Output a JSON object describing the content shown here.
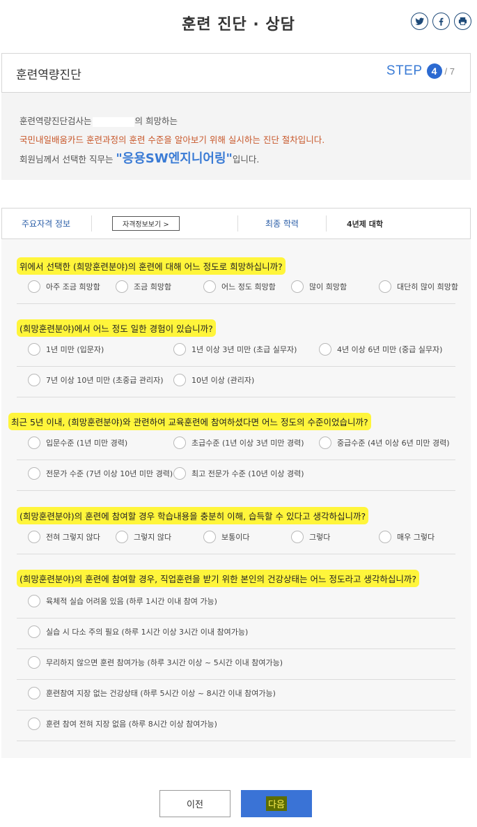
{
  "header": {
    "title": "훈련 진단 · 상담",
    "share_icons": [
      "twitter-icon",
      "facebook-icon",
      "print-icon"
    ],
    "accent_color": "#1e4a78"
  },
  "step": {
    "title": "훈련역량진단",
    "label": "STEP",
    "current": "4",
    "total": "/ 7"
  },
  "intro": {
    "line1_prefix": "훈련역량진단검사는",
    "line1_suffix": "의 희망하는",
    "line2": "국민내일배움카드 훈련과정의 훈련 수준을 알아보기 위해 실시하는 진단 절차입니다.",
    "line3_prefix": "회원님께서 선택한 직무는 ",
    "job": "\"응용SW엔지니어링\"",
    "line3_suffix": "입니다."
  },
  "info": {
    "cert_label": "주요자격 정보",
    "cert_button": "자격정보보기 >",
    "edu_label": "최종 학력",
    "edu_value": "4년제 대학"
  },
  "questions": [
    {
      "text": "위에서 선택한 (희망훈련분야)의 훈련에 대해 어느 정도로 희망하십니까?",
      "rows": [
        [
          "아주 조금 희망함",
          "조금 희망함",
          "어느 정도 희망함",
          "많이 희망함",
          "대단히 많이 희망함"
        ]
      ]
    },
    {
      "text": "(희망훈련분야)에서 어느 정도 일한 경험이 있습니까?",
      "rows": [
        [
          "1년 미만 (입문자)",
          "1년 이상 3년 미만 (초급 실무자)",
          "4년 이상 6년 미만 (중급 실무자)"
        ],
        [
          "7년 이상 10년 미만 (초중급 관리자)",
          "10년 이상 (관리자)"
        ]
      ]
    },
    {
      "text": "최근 5년 이내, (희망훈련분야)와 관련하여 교육훈련에 참여하셨다면 어느 정도의 수준이었습니까?",
      "rows": [
        [
          "입문수준 (1년 미만 경력)",
          "초급수준 (1년 이상 3년 미만 경력)",
          "중급수준 (4년 이상 6년 미만 경력)"
        ],
        [
          "전문가 수준 (7년 이상 10년 미만 경력)",
          "최고 전문가 수준 (10년 이상 경력)"
        ]
      ]
    },
    {
      "text": "(희망훈련분야)의 훈련에 참여할 경우 학습내용을 충분히 이해, 습득할 수 있다고 생각하십니까?",
      "rows": [
        [
          "전혀 그렇지 않다",
          "그렇지 않다",
          "보통이다",
          "그렇다",
          "매우 그렇다"
        ]
      ]
    },
    {
      "text": "(희망훈련분야)의 훈련에 참여할 경우, 직업훈련을 받기 위한 본인의 건강상태는 어느 정도라고 생각하십니까?",
      "rows": [
        [
          "육체적 실습 어려움 있음 (하루 1시간 이내 참여 가능)"
        ],
        [
          "실습 시 다소 주의 필요 (하루 1시간 이상 3시간 이내 참여가능)"
        ],
        [
          "무리하지 않으면 훈련 참여가능 (하루 3시간 이상 ~ 5시간 이내 참여가능)"
        ],
        [
          "훈련참여 지장 없는 건강상태 (하루 5시간 이상 ~ 8시간 이내 참여가능)"
        ],
        [
          "훈련 참여 전혀 지장 없음 (하루 8시간 이상 참여가능)"
        ]
      ]
    }
  ],
  "buttons": {
    "prev": "이전",
    "next": "다음"
  }
}
